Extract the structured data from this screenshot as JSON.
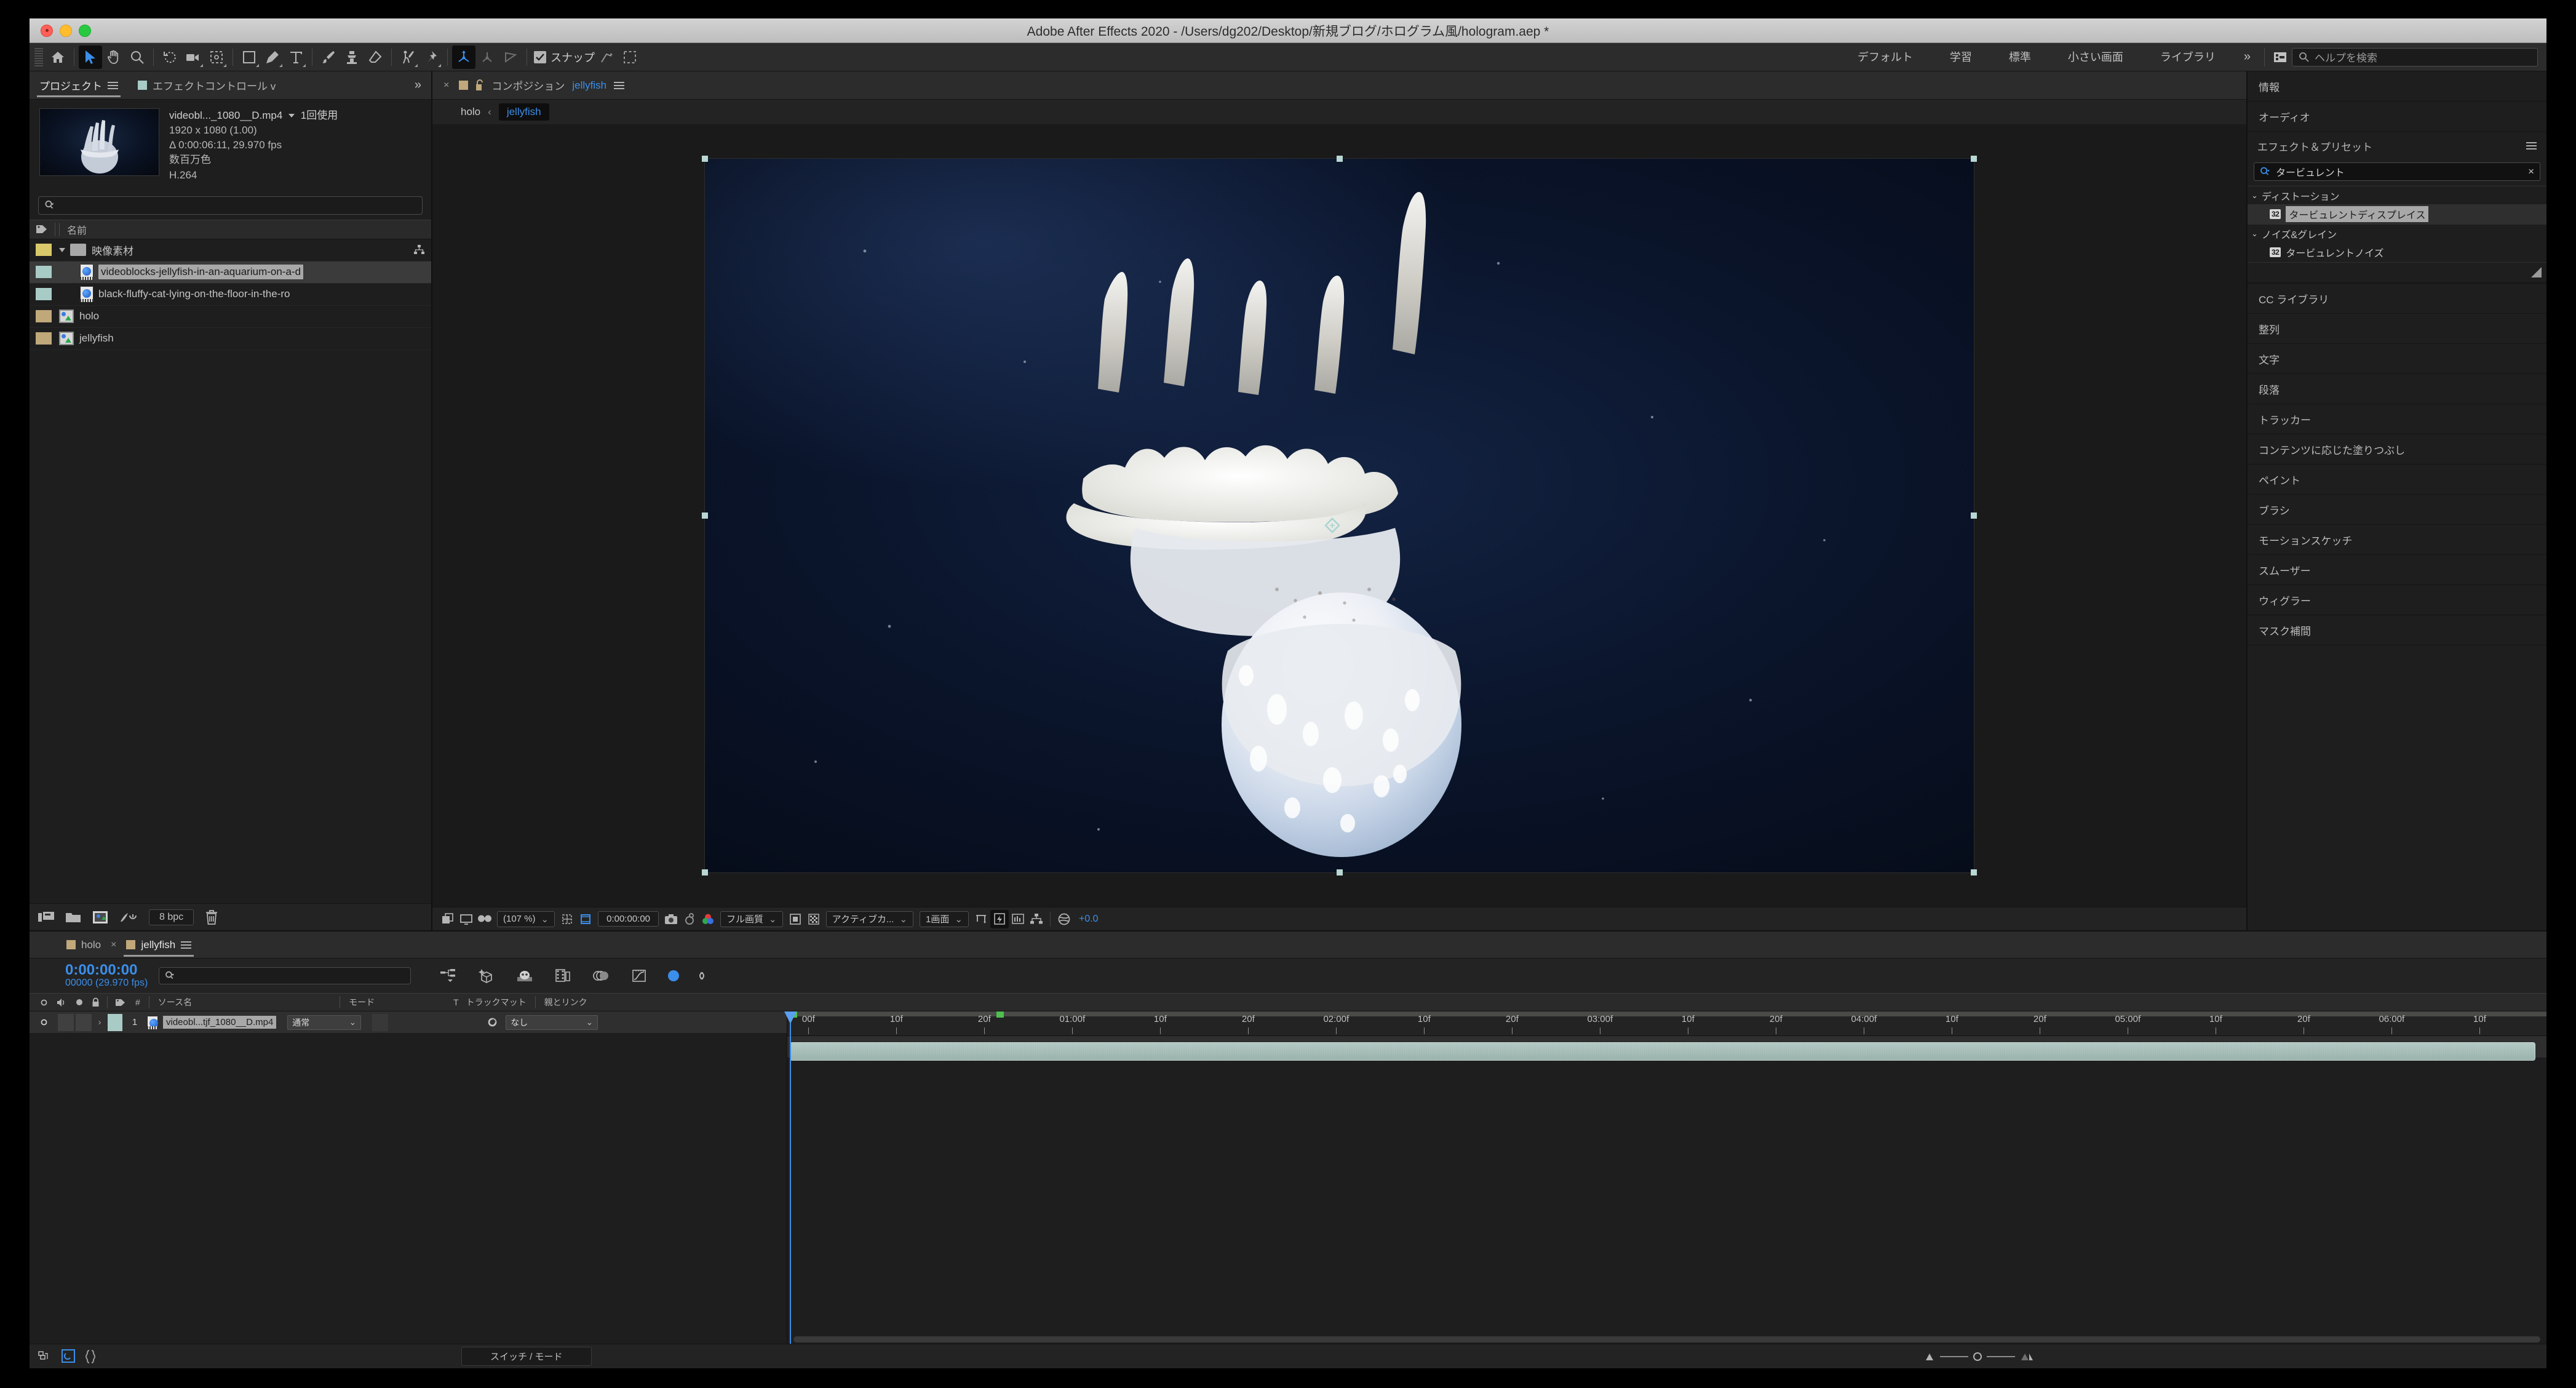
{
  "window": {
    "title": "Adobe After Effects 2020 - /Users/dg202/Desktop/新規ブログ/ホログラム風/hologram.aep *"
  },
  "toolbar": {
    "snap_label": "スナップ",
    "workspaces": [
      "デフォルト",
      "学習",
      "標準",
      "小さい画面",
      "ライブラリ"
    ],
    "more_chevron": "»",
    "help_placeholder": "ヘルプを検索"
  },
  "project_panel": {
    "tabs": [
      {
        "label": "プロジェクト",
        "selected": true
      },
      {
        "label": "エフェクトコントロール v",
        "selected": false
      }
    ],
    "overflow": "»",
    "selected_asset": {
      "name": "videobl..._1080__D.mp4",
      "usage": "1回使用",
      "resolution": "1920 x 1080 (1.00)",
      "duration": "Δ 0:00:06:11, 29.970 fps",
      "color": "数百万色",
      "codec": "H.264"
    },
    "column_header": "名前",
    "items": [
      {
        "name": "映像素材",
        "type": "folder",
        "depth": 0,
        "label_color": "#d9c96a",
        "expanded": true,
        "selected": false
      },
      {
        "name": "videoblocks-jellyfish-in-an-aquarium-on-a-d",
        "type": "footage",
        "depth": 1,
        "label_color": "#a9cbc6",
        "selected": true
      },
      {
        "name": "black-fluffy-cat-lying-on-the-floor-in-the-ro",
        "type": "footage",
        "depth": 1,
        "label_color": "#a9cbc6",
        "selected": false
      },
      {
        "name": "holo",
        "type": "comp",
        "depth": 0,
        "label_color": "#c0a87a",
        "selected": false
      },
      {
        "name": "jellyfish",
        "type": "comp",
        "depth": 0,
        "label_color": "#c0a87a",
        "selected": false
      }
    ],
    "footer": {
      "bit_depth": "8 bpc"
    }
  },
  "composition_panel": {
    "tab_label": "コンポジション",
    "tab_comp_name": "jellyfish",
    "breadcrumb_parent": "holo",
    "breadcrumb_current": "jellyfish",
    "toolbar": {
      "zoom": "(107 %)",
      "timecode": "0:00:00:00",
      "quality": "フル画質",
      "view_layout": "アクティブカ...",
      "views": "1画面",
      "exposure": "+0.0"
    }
  },
  "right_panels": {
    "info": "情報",
    "audio": "オーディオ",
    "effects_presets": {
      "title": "エフェクト＆プリセット",
      "search_value": "タービュレント",
      "clear_icon": "×",
      "categories": [
        {
          "name": "ディストーション",
          "items": [
            {
              "label": "タービュレントディスプレイス",
              "badge": "32",
              "selected": true
            }
          ]
        },
        {
          "name": "ノイズ&グレイン",
          "items": [
            {
              "label": "タービュレントノイズ",
              "badge": "32",
              "selected": false
            }
          ]
        }
      ]
    },
    "strips": [
      "CC ライブラリ",
      "整列",
      "文字",
      "段落",
      "トラッカー",
      "コンテンツに応じた塗りつぶし",
      "ペイント",
      "ブラシ",
      "モーションスケッチ",
      "スムーザー",
      "ウィグラー",
      "マスク補間"
    ]
  },
  "timeline": {
    "tabs": [
      {
        "label": "holo",
        "selected": false,
        "color": "#c0a87a"
      },
      {
        "label": "jellyfish",
        "selected": true,
        "color": "#c0a87a"
      }
    ],
    "current_time": "0:00:00:00",
    "frame_info": "00000 (29.970 fps)",
    "columns": [
      "#",
      "ソース名",
      "モード",
      "T",
      "トラックマット",
      "親とリンク"
    ],
    "layers": [
      {
        "index": "1",
        "source_name": "videobl...tjf_1080__D.mp4",
        "mode": "通常",
        "track_matte": "",
        "parent": "なし",
        "label_color": "#a9cbc6",
        "selected": true
      }
    ],
    "ruler_ticks": [
      "00f",
      "10f",
      "20f",
      "01:00f",
      "10f",
      "20f",
      "02:00f",
      "10f",
      "20f",
      "03:00f",
      "10f",
      "20f",
      "04:00f",
      "10f",
      "20f",
      "05:00f",
      "10f",
      "20f",
      "06:00f",
      "10f"
    ],
    "footer": {
      "switches_modes": "スイッチ / モード"
    }
  }
}
